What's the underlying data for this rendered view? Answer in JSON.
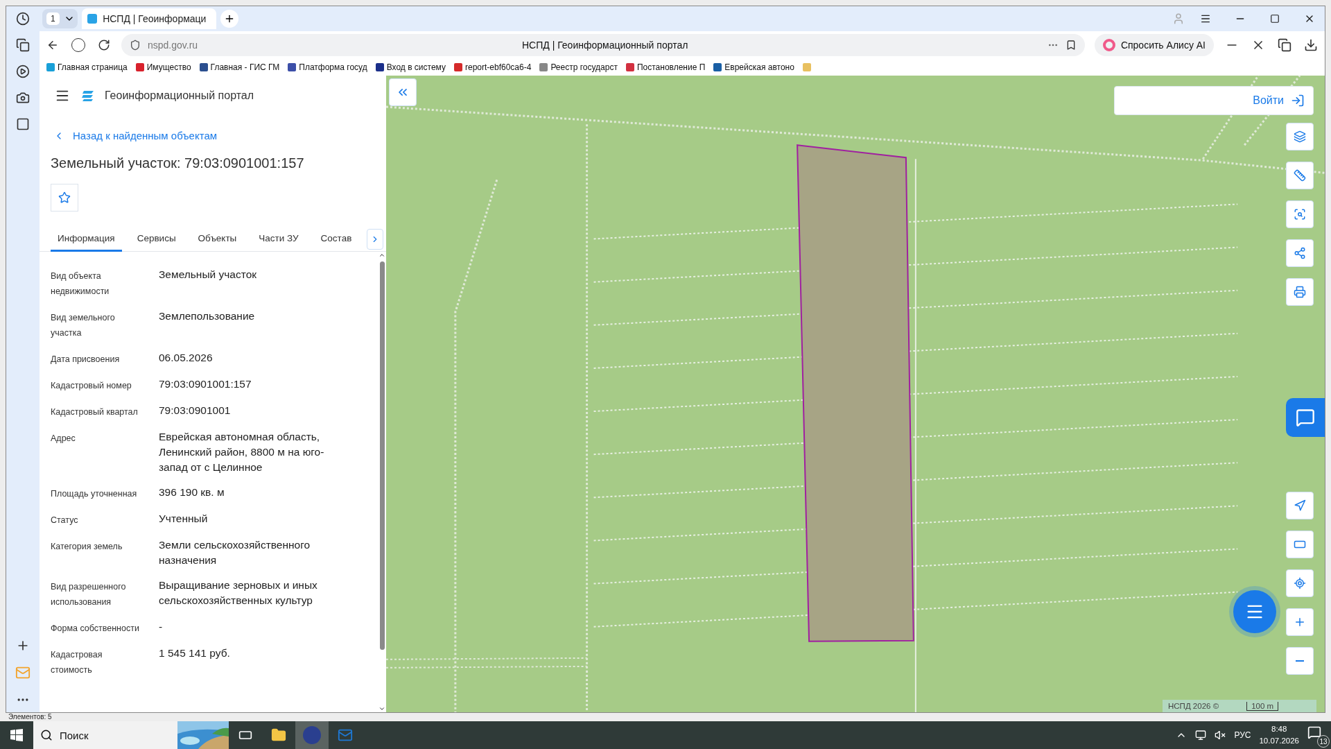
{
  "browser": {
    "tab_count": "1",
    "tabs": [
      {
        "title": "НСПД | Геоинформаци",
        "selected": true
      }
    ],
    "address": "nspd.gov.ru",
    "page_title": "НСПД | Геоинформационный портал",
    "alice_button": "Спросить Алису AI",
    "bookmarks": [
      "Главная страница",
      "Имущество",
      "Главная - ГИС ГМ",
      "Платформа госуд",
      "Вход в систему",
      "report-ebf60ca6-4",
      "Реестр государст",
      "Постановление П",
      "Еврейская автоно"
    ]
  },
  "portal": {
    "title": "Геоинформационный портал",
    "back_link": "Назад к найденным объектам",
    "object_title": "Земельный участок: 79:03:0901001:157",
    "tabs": [
      {
        "label": "Информация",
        "selected": true
      },
      {
        "label": "Сервисы",
        "selected": false
      },
      {
        "label": "Объекты",
        "selected": false
      },
      {
        "label": "Части ЗУ",
        "selected": false
      },
      {
        "label": "Состав",
        "selected": false
      }
    ],
    "fields": [
      {
        "label": "Вид объекта недвижимости",
        "value": "Земельный участок"
      },
      {
        "label": "Вид земельного участка",
        "value": "Землепользование"
      },
      {
        "label": "Дата присвоения",
        "value": "06.05.2026"
      },
      {
        "label": "Кадастровый номер",
        "value": "79:03:0901001:157"
      },
      {
        "label": "Кадастровый квартал",
        "value": "79:03:0901001"
      },
      {
        "label": "Адрес",
        "value": "Еврейская автономная область, Ленинский район, 8800 м на юго-запад от с Целинное"
      },
      {
        "label": "Площадь уточненная",
        "value": "396 190 кв. м"
      },
      {
        "label": "Статус",
        "value": "Учтенный"
      },
      {
        "label": "Категория земель",
        "value": "Земли сельскохозяйственного назначения"
      },
      {
        "label": "Вид разрешенного использования",
        "value": "Выращивание зерновых и иных сельскохозяйственных культур"
      },
      {
        "label": "Форма собственности",
        "value": "-"
      },
      {
        "label": "Кадастровая стоимость",
        "value": "1 545 141 руб."
      }
    ]
  },
  "map": {
    "login_button": "Войти",
    "attribution": "НСПД 2026 ©",
    "scale": "100 m"
  },
  "status_text": "Элементов: 5",
  "taskbar": {
    "search": "Поиск",
    "language": "РУС",
    "time": "8:48",
    "date": "10.07.2026",
    "notifications": "13"
  }
}
